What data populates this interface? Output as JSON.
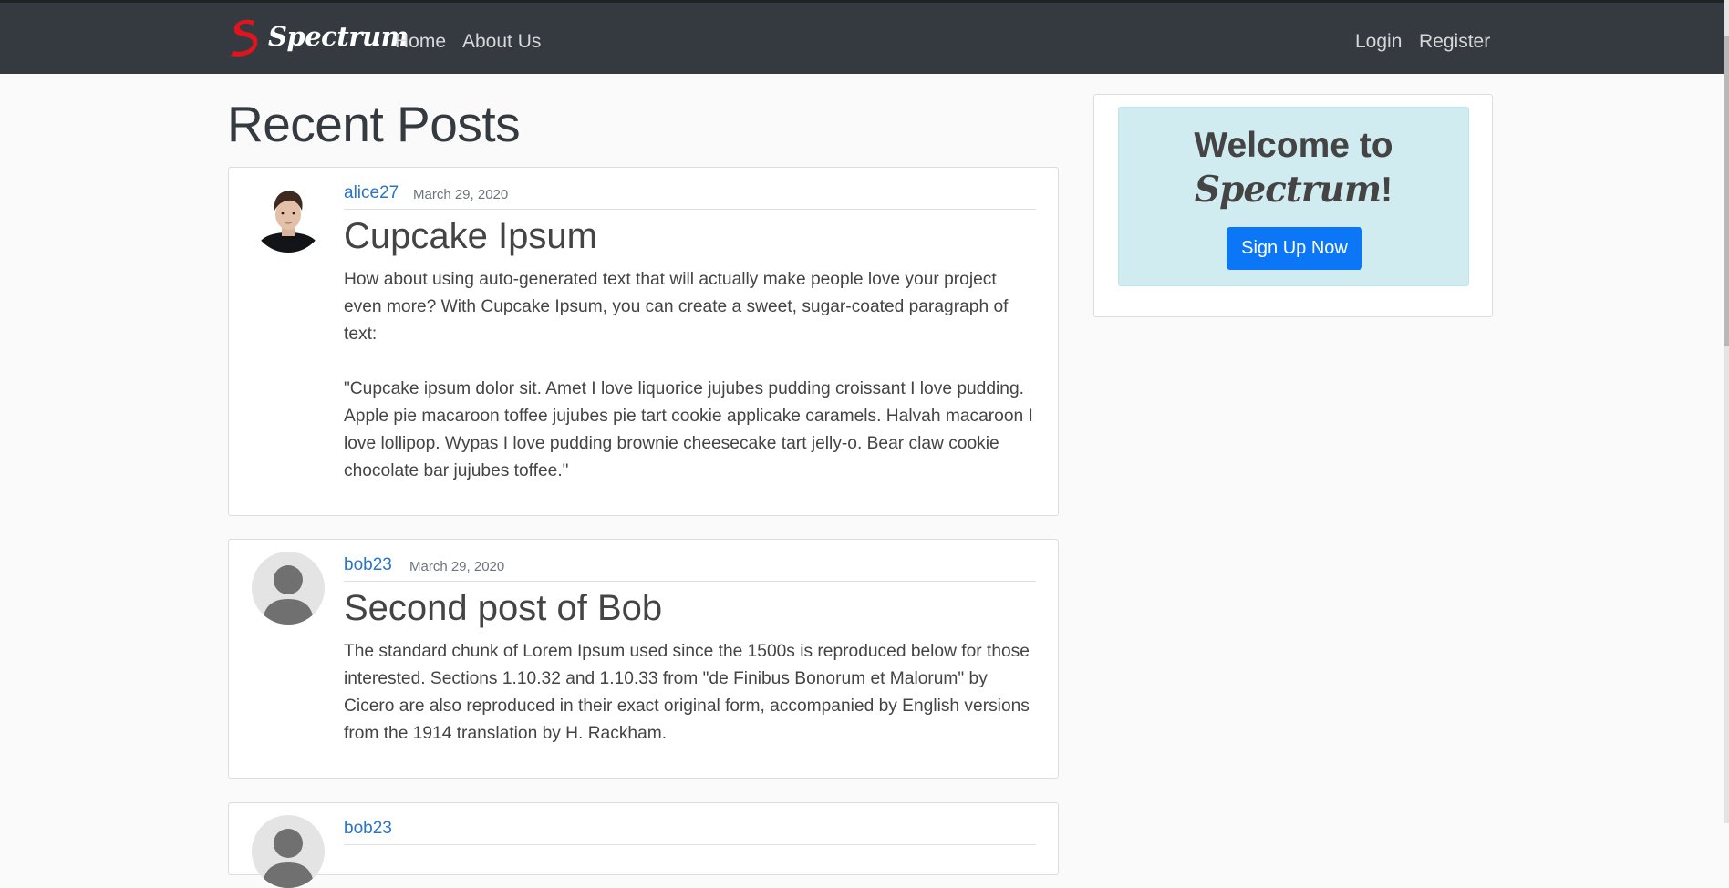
{
  "navbar": {
    "brand_name": "Spectrum",
    "links": {
      "home": "Home",
      "about": "About Us",
      "login": "Login",
      "register": "Register"
    }
  },
  "main": {
    "heading": "Recent Posts",
    "posts": [
      {
        "author": "alice27",
        "date": "March 29, 2020",
        "title": "Cupcake Ipsum",
        "paragraphs": [
          "How about using auto-generated text that will actually make people love your project even more? With Cupcake Ipsum, you can create a sweet, sugar-coated paragraph of text:",
          "\"Cupcake ipsum dolor sit. Amet I love liquorice jujubes pudding croissant I love pudding. Apple pie macaroon toffee jujubes pie tart cookie applicake caramels. Halvah macaroon I love lollipop. Wypas I love pudding brownie cheesecake tart jelly-o. Bear claw cookie chocolate bar jujubes toffee.\""
        ]
      },
      {
        "author": "bob23",
        "date": "March 29, 2020",
        "title": "Second post of Bob",
        "paragraphs": [
          "The standard chunk of Lorem Ipsum used since the 1500s is reproduced below for those interested. Sections 1.10.32 and 1.10.33 from \"de Finibus Bonorum et Malorum\" by Cicero are also reproduced in their exact original form, accompanied by English versions from the 1914 translation by H. Rackham."
        ]
      },
      {
        "author": "bob23"
      }
    ]
  },
  "sidebar": {
    "welcome_prefix": "Welcome to",
    "welcome_brand": "Spectrum",
    "welcome_suffix": "!",
    "signup_label": "Sign Up Now"
  },
  "colors": {
    "navbar_bg": "#343a40",
    "page_bg": "#fafafa",
    "link": "#2a74c6",
    "accent_button": "#0b77f6",
    "welcome_bg": "#d1ecf1",
    "logo_red": "#e0141e"
  },
  "icons": {
    "brand": "spectrum-logo-icon",
    "avatar_default": "default-user-avatar-icon"
  }
}
